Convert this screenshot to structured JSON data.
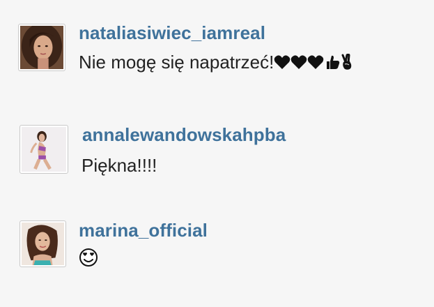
{
  "comments": [
    {
      "username": "nataliasiwiec_iamreal",
      "text": "Nie mogę się napatrzeć!",
      "emojis": [
        "black-heart-icon",
        "black-heart-icon",
        "black-heart-icon",
        "thumbs-up-icon",
        "victory-hand-icon"
      ]
    },
    {
      "username": "annalewandowskahpba",
      "text": "Piękna!!!!",
      "emojis": []
    },
    {
      "username": "marina_official",
      "text": "",
      "emojis": [
        "smiling-heart-eyes-face-icon"
      ]
    }
  ],
  "colors": {
    "username": "#3f729b",
    "text": "#222222",
    "background": "#f6f6f6"
  }
}
